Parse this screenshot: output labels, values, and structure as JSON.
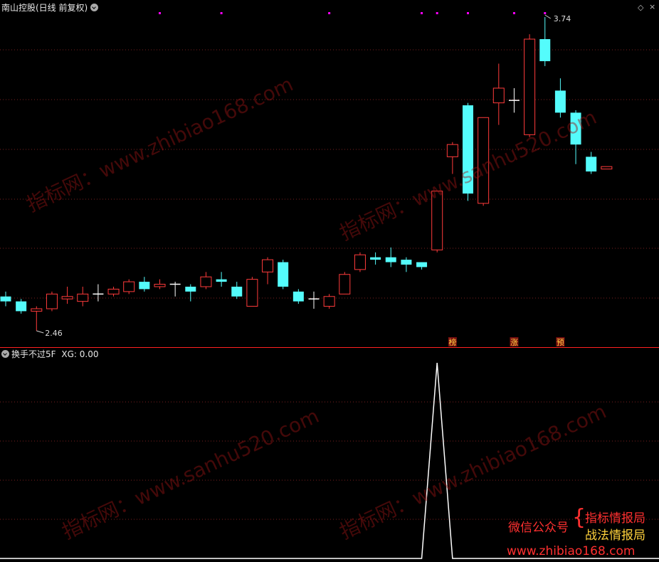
{
  "header": {
    "title": "南山控股(日线 前复权)"
  },
  "indicator": {
    "title": "换手不过5F",
    "value_label": "XG: 0.00"
  },
  "candles": [
    {
      "o": 2.6,
      "c": 2.58,
      "h": 2.62,
      "l": 2.56
    },
    {
      "o": 2.58,
      "c": 2.54,
      "h": 2.59,
      "l": 2.53
    },
    {
      "o": 2.54,
      "c": 2.55,
      "h": 2.56,
      "l": 2.46
    },
    {
      "o": 2.55,
      "c": 2.61,
      "h": 2.62,
      "l": 2.54
    },
    {
      "o": 2.59,
      "c": 2.6,
      "h": 2.64,
      "l": 2.57
    },
    {
      "o": 2.58,
      "c": 2.61,
      "h": 2.64,
      "l": 2.56
    },
    {
      "o": 2.61,
      "c": 2.61,
      "h": 2.65,
      "l": 2.58
    },
    {
      "o": 2.61,
      "c": 2.63,
      "h": 2.64,
      "l": 2.6
    },
    {
      "o": 2.62,
      "c": 2.66,
      "h": 2.67,
      "l": 2.61
    },
    {
      "o": 2.66,
      "c": 2.63,
      "h": 2.68,
      "l": 2.62
    },
    {
      "o": 2.64,
      "c": 2.65,
      "h": 2.67,
      "l": 2.63
    },
    {
      "o": 2.65,
      "c": 2.65,
      "h": 2.66,
      "l": 2.6
    },
    {
      "o": 2.64,
      "c": 2.62,
      "h": 2.65,
      "l": 2.58
    },
    {
      "o": 2.64,
      "c": 2.68,
      "h": 2.7,
      "l": 2.63
    },
    {
      "o": 2.67,
      "c": 2.66,
      "h": 2.7,
      "l": 2.64
    },
    {
      "o": 2.64,
      "c": 2.6,
      "h": 2.66,
      "l": 2.59
    },
    {
      "o": 2.56,
      "c": 2.67,
      "h": 2.68,
      "l": 2.56
    },
    {
      "o": 2.7,
      "c": 2.75,
      "h": 2.76,
      "l": 2.65
    },
    {
      "o": 2.74,
      "c": 2.64,
      "h": 2.75,
      "l": 2.63
    },
    {
      "o": 2.62,
      "c": 2.58,
      "h": 2.63,
      "l": 2.57
    },
    {
      "o": 2.59,
      "c": 2.59,
      "h": 2.62,
      "l": 2.55
    },
    {
      "o": 2.56,
      "c": 2.6,
      "h": 2.61,
      "l": 2.55
    },
    {
      "o": 2.61,
      "c": 2.69,
      "h": 2.7,
      "l": 2.61
    },
    {
      "o": 2.71,
      "c": 2.77,
      "h": 2.78,
      "l": 2.7
    },
    {
      "o": 2.76,
      "c": 2.75,
      "h": 2.78,
      "l": 2.73
    },
    {
      "o": 2.76,
      "c": 2.74,
      "h": 2.8,
      "l": 2.72
    },
    {
      "o": 2.75,
      "c": 2.73,
      "h": 2.76,
      "l": 2.7
    },
    {
      "o": 2.74,
      "c": 2.72,
      "h": 2.74,
      "l": 2.71
    },
    {
      "o": 2.79,
      "c": 3.03,
      "h": 3.03,
      "l": 2.78
    },
    {
      "o": 3.17,
      "c": 3.22,
      "h": 3.23,
      "l": 3.1
    },
    {
      "o": 3.38,
      "c": 3.02,
      "h": 3.39,
      "l": 2.99
    },
    {
      "o": 2.98,
      "c": 3.33,
      "h": 3.33,
      "l": 2.97
    },
    {
      "o": 3.39,
      "c": 3.45,
      "h": 3.55,
      "l": 3.3
    },
    {
      "o": 3.4,
      "c": 3.4,
      "h": 3.45,
      "l": 3.35
    },
    {
      "o": 3.26,
      "c": 3.65,
      "h": 3.67,
      "l": 3.25
    },
    {
      "o": 3.65,
      "c": 3.56,
      "h": 3.74,
      "l": 3.54
    },
    {
      "o": 3.44,
      "c": 3.35,
      "h": 3.49,
      "l": 3.33
    },
    {
      "o": 3.35,
      "c": 3.22,
      "h": 3.36,
      "l": 3.14
    },
    {
      "o": 3.17,
      "c": 3.11,
      "h": 3.19,
      "l": 3.1
    },
    {
      "o": 3.12,
      "c": 3.13,
      "h": 3.13,
      "l": 3.12
    }
  ],
  "price_labels": {
    "high": "3.74",
    "low": "2.46"
  },
  "signal_tags": [
    {
      "index": 29,
      "text": "榜"
    },
    {
      "index": 33,
      "text": "涨"
    },
    {
      "index": 36,
      "text": "预"
    }
  ],
  "signal_dots": [
    -8,
    -5,
    10,
    14,
    21,
    27,
    28,
    30,
    33,
    35
  ],
  "indicator_values": [
    0,
    0,
    0,
    0,
    0,
    0,
    0,
    0,
    0,
    0,
    0,
    0,
    0,
    0,
    0,
    0,
    0,
    0,
    0,
    0,
    0,
    0,
    0,
    0,
    0,
    0,
    0,
    0,
    1,
    0,
    0,
    0,
    0,
    0,
    0,
    0,
    0,
    0,
    0,
    0
  ],
  "watermarks": [
    "指标网：www.zhibiao168.com",
    "指标网：www.sanhu520.com",
    "指标网：www.sanhu520.com",
    "指标网：www.zhibiao168.com"
  ],
  "promo": {
    "line1": "微信公众号",
    "brace": "{",
    "line2a": "指标情报局",
    "line2b": "战法情报局",
    "url": "www.zhibiao168.com"
  },
  "colors": {
    "up": "#ff3b3b",
    "down": "#54fcfc",
    "grid": "#7a1f1f",
    "axis": "#ff2020",
    "dot": "#ff00ff",
    "tagText": "#ffd040",
    "tagBg": "#7a1010"
  }
}
